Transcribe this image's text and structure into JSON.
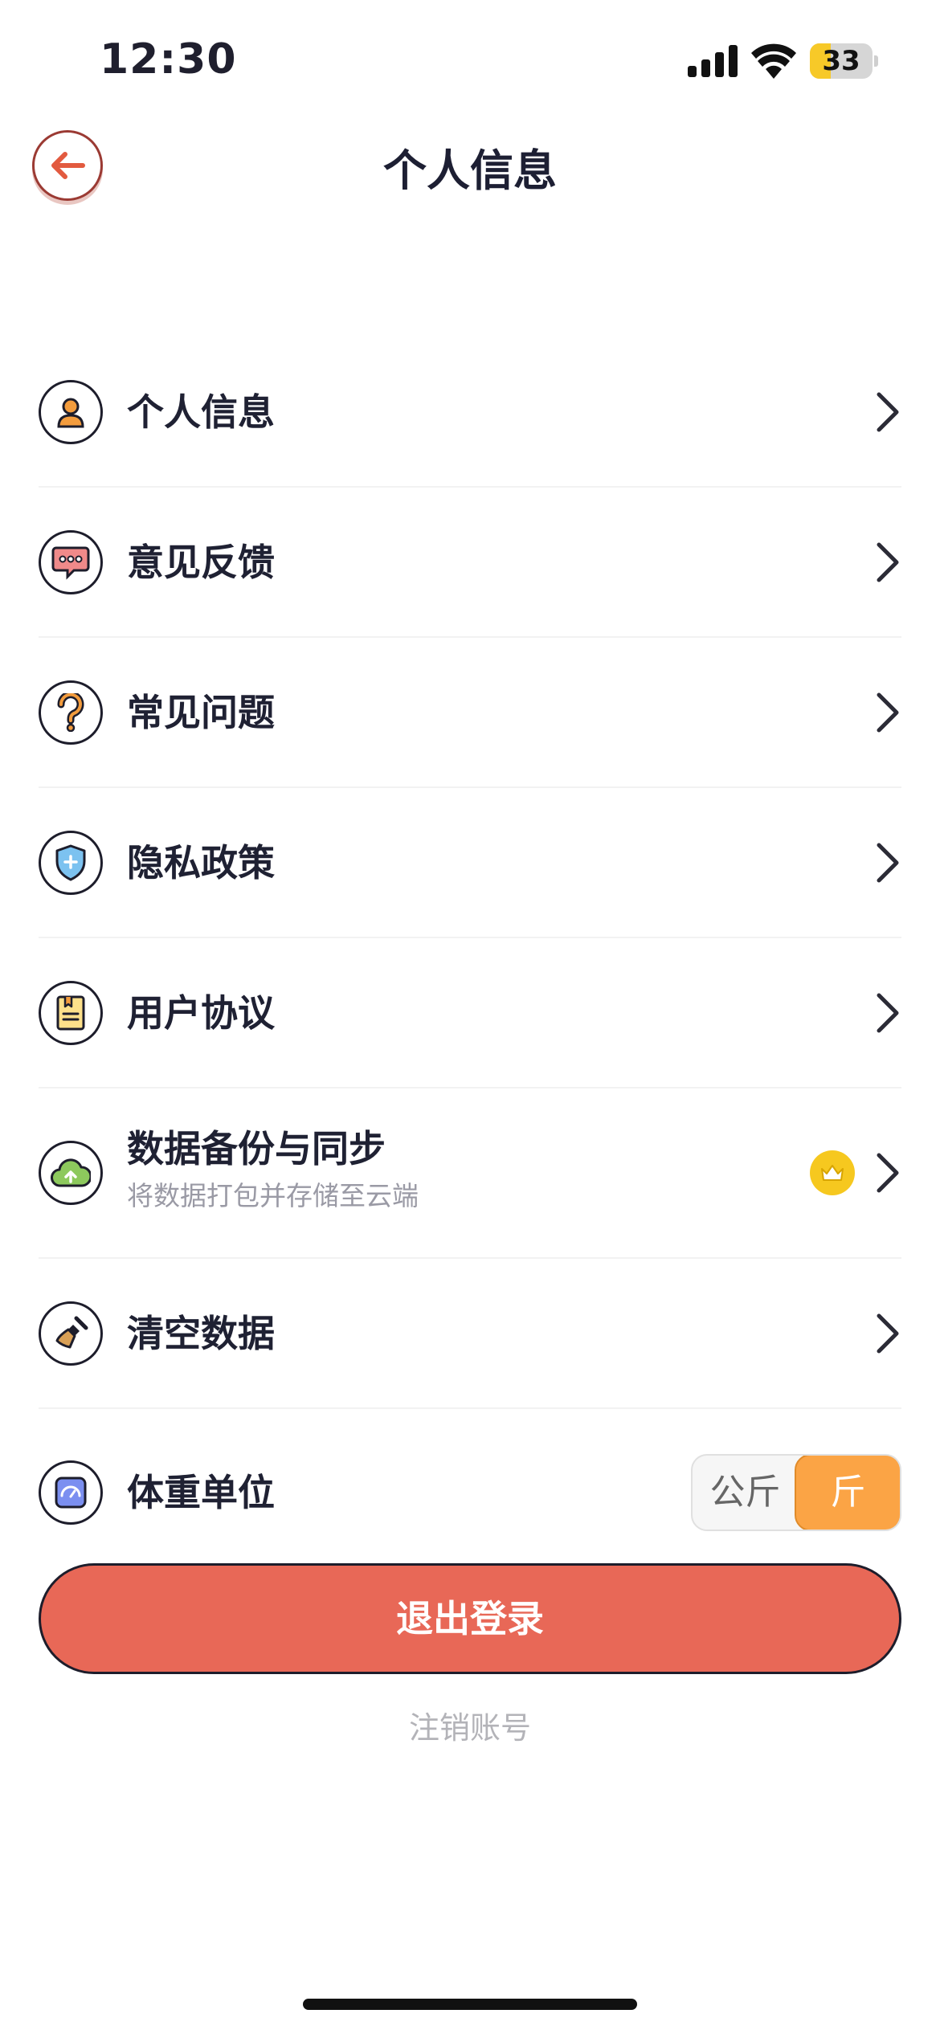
{
  "status_bar": {
    "time": "12:30",
    "battery": "33",
    "battery_level": 0.33
  },
  "header": {
    "title": "个人信息"
  },
  "menu": [
    {
      "label": "个人信息",
      "icon": "user-icon"
    },
    {
      "label": "意见反馈",
      "icon": "chat-bubble-icon"
    },
    {
      "label": "常见问题",
      "icon": "question-icon"
    },
    {
      "label": "隐私政策",
      "icon": "shield-icon"
    },
    {
      "label": "用户协议",
      "icon": "document-icon"
    },
    {
      "label": "数据备份与同步",
      "subtitle": "将数据打包并存储至云端",
      "icon": "cloud-upload-icon",
      "badge": "crown-icon"
    },
    {
      "label": "清空数据",
      "icon": "broom-icon"
    },
    {
      "label": "体重单位",
      "icon": "scale-icon"
    }
  ],
  "weight_unit": {
    "options": [
      "公斤",
      "斤"
    ],
    "selected": "斤"
  },
  "logout_label": "退出登录",
  "delete_account_label": "注销账号",
  "colors": {
    "accent_orange": "#fba445",
    "logout_red": "#e86857",
    "crown_yellow": "#f6c81f"
  }
}
